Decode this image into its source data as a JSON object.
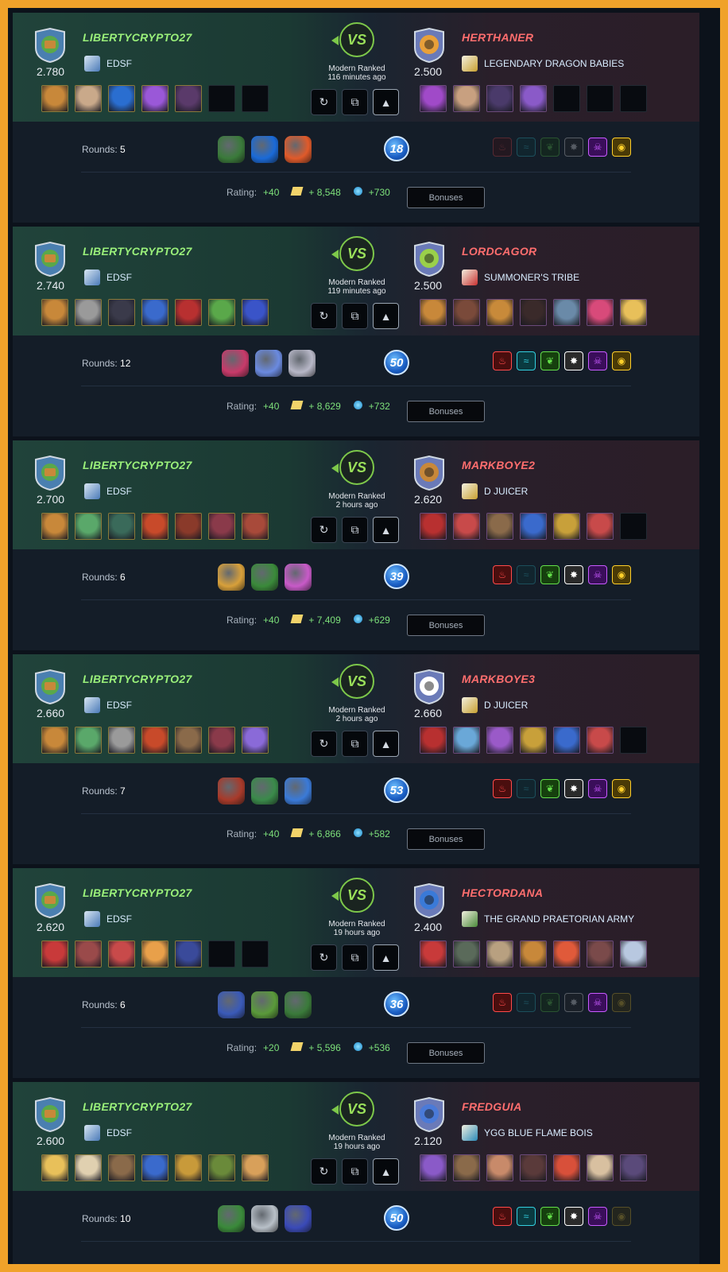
{
  "colors": {
    "accent_win": "#9af07a",
    "accent_loss": "#ff6e6e",
    "frame": "#f0a22a"
  },
  "battles": [
    {
      "player": {
        "name": "LIBERTYCRYPTO27",
        "rating": "2.780",
        "guild": "EDSF"
      },
      "opponent": {
        "name": "HERTHANER",
        "rating": "2.500",
        "guild": "LEGENDARY DRAGON BABIES"
      },
      "vs": "VS",
      "mode": "Modern Ranked",
      "time": "116 minutes ago",
      "rounds_label": "Rounds:",
      "rounds": "5",
      "mana": "18",
      "rating_label": "Rating:",
      "rating_change": "+40",
      "dec": "+ 8,548",
      "sps": "+730",
      "bonuses_label": "Bonuses"
    },
    {
      "player": {
        "name": "LIBERTYCRYPTO27",
        "rating": "2.740",
        "guild": "EDSF"
      },
      "opponent": {
        "name": "LORDCAGOR",
        "rating": "2.500",
        "guild": "SUMMONER'S TRIBE"
      },
      "vs": "VS",
      "mode": "Modern Ranked",
      "time": "119 minutes ago",
      "rounds_label": "Rounds:",
      "rounds": "12",
      "mana": "50",
      "rating_label": "Rating:",
      "rating_change": "+40",
      "dec": "+ 8,629",
      "sps": "+732",
      "bonuses_label": "Bonuses"
    },
    {
      "player": {
        "name": "LIBERTYCRYPTO27",
        "rating": "2.700",
        "guild": "EDSF"
      },
      "opponent": {
        "name": "MARKBOYE2",
        "rating": "2.620",
        "guild": "D JUICER"
      },
      "vs": "VS",
      "mode": "Modern Ranked",
      "time": "2 hours ago",
      "rounds_label": "Rounds:",
      "rounds": "6",
      "mana": "39",
      "rating_label": "Rating:",
      "rating_change": "+40",
      "dec": "+ 7,409",
      "sps": "+629",
      "bonuses_label": "Bonuses"
    },
    {
      "player": {
        "name": "LIBERTYCRYPTO27",
        "rating": "2.660",
        "guild": "EDSF"
      },
      "opponent": {
        "name": "MARKBOYE3",
        "rating": "2.660",
        "guild": "D JUICER"
      },
      "vs": "VS",
      "mode": "Modern Ranked",
      "time": "2 hours ago",
      "rounds_label": "Rounds:",
      "rounds": "7",
      "mana": "53",
      "rating_label": "Rating:",
      "rating_change": "+40",
      "dec": "+ 6,866",
      "sps": "+582",
      "bonuses_label": "Bonuses"
    },
    {
      "player": {
        "name": "LIBERTYCRYPTO27",
        "rating": "2.620",
        "guild": "EDSF"
      },
      "opponent": {
        "name": "HECTORDANA",
        "rating": "2.400",
        "guild": "THE GRAND PRAETORIAN ARMY"
      },
      "vs": "VS",
      "mode": "Modern Ranked",
      "time": "19 hours ago",
      "rounds_label": "Rounds:",
      "rounds": "6",
      "mana": "36",
      "rating_label": "Rating:",
      "rating_change": "+20",
      "dec": "+ 5,596",
      "sps": "+536",
      "bonuses_label": "Bonuses"
    },
    {
      "player": {
        "name": "LIBERTYCRYPTO27",
        "rating": "2.600",
        "guild": "EDSF"
      },
      "opponent": {
        "name": "FREDGUIA",
        "rating": "2.120",
        "guild": "YGG BLUE FLAME BOIS"
      },
      "vs": "VS",
      "mode": "Modern Ranked",
      "time": "19 hours ago",
      "rounds_label": "Rounds:",
      "rounds": "10",
      "mana": "50",
      "rating_label": "Rating:",
      "rating_change": "",
      "dec": "",
      "sps": "",
      "bonuses_label": ""
    }
  ],
  "icons": {
    "replay": "replay-icon",
    "copy": "copy-icon",
    "collapse": "chevron-up-icon"
  }
}
